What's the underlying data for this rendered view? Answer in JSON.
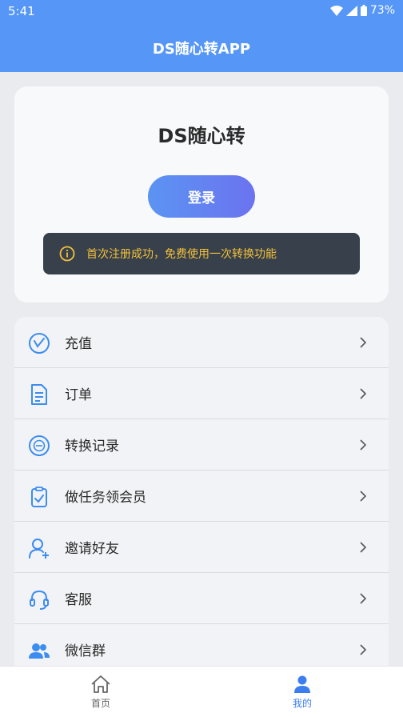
{
  "status_bar": {
    "time": "5:41",
    "battery": "73%"
  },
  "header": {
    "title": "DS随心转APP"
  },
  "login_card": {
    "brand": "DS随心转",
    "login_label": "登录",
    "notice": "首次注册成功，免费使用一次转换功能"
  },
  "menu": {
    "items": [
      {
        "label": "充值",
        "icon": "recharge-icon"
      },
      {
        "label": "订单",
        "icon": "order-document-icon"
      },
      {
        "label": "转换记录",
        "icon": "conversion-record-icon"
      },
      {
        "label": "做任务领会员",
        "icon": "task-clipboard-icon"
      },
      {
        "label": "邀请好友",
        "icon": "invite-user-icon"
      },
      {
        "label": "客服",
        "icon": "headset-icon"
      },
      {
        "label": "微信群",
        "icon": "group-users-icon"
      }
    ]
  },
  "tabbar": {
    "home": "首页",
    "mine": "我的"
  },
  "colors": {
    "primary": "#5596f6",
    "icon_blue": "#3c8df0",
    "notice_text": "#f4c13a",
    "notice_bg": "#37404b"
  }
}
